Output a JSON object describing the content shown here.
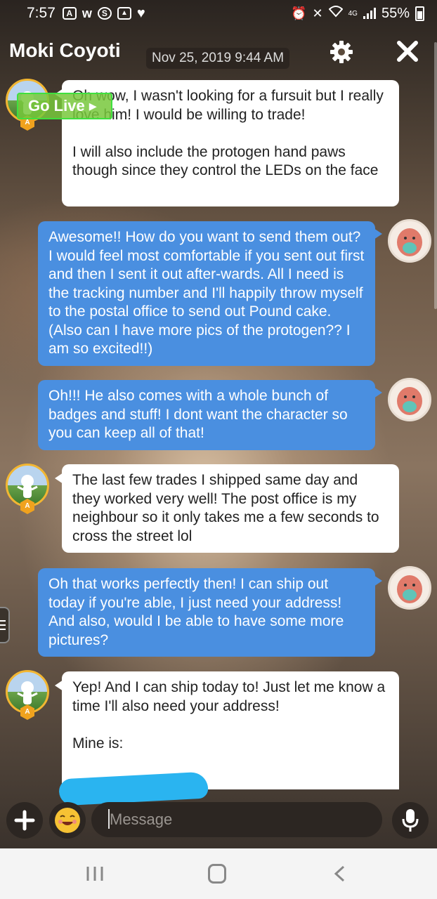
{
  "status_bar": {
    "time": "7:57",
    "network": "4G",
    "battery": "55%",
    "left_icons": [
      "amino-icon",
      "w-icon",
      "s-icon",
      "gallery-icon",
      "heart-icon"
    ],
    "right_icons": [
      "alarm-icon",
      "mute-icon",
      "wifi-icon",
      "signal-icon",
      "battery-icon"
    ]
  },
  "header": {
    "title": "Moki Coyoti",
    "date": "Nov 25, 2019 9:44 AM"
  },
  "go_live_label": "Go Live",
  "messages": [
    {
      "sender": "other",
      "text": "Oh wow, I wasn't looking for a fursuit but I really love him! I would be willing to trade!\n\nI will also include the protogen hand paws though since they control the LEDs on the face"
    },
    {
      "sender": "me",
      "text": "Awesome!! How do you want to send them out? I would feel most comfortable if you sent out first and then I sent it out after-wards. All I need is the tracking number and I'll happily throw myself to the postal office to send out Pound cake. (Also can I have more pics of the protogen?? I am so excited!!)"
    },
    {
      "sender": "me",
      "text": "Oh!!! He also comes with a whole bunch of badges and stuff! I dont want the character so you can keep all of that!"
    },
    {
      "sender": "other",
      "text": "The last few trades I shipped same day and they worked very well! The post office is my neighbour so it only takes me a few seconds to cross the street lol"
    },
    {
      "sender": "me",
      "text": "Oh that works perfectly then! I can ship out today if you're able, I just need your address! And also, would I be able to have some more pictures?"
    },
    {
      "sender": "other",
      "text": "Yep! And I can ship today to! Just let me know a time I'll also need your address!\n\nMine is:"
    }
  ],
  "input": {
    "placeholder": "Message"
  },
  "colors": {
    "outgoing_bubble": "#4a8fe0",
    "incoming_bubble": "#ffffff",
    "avatar_ring": "#f2b632",
    "go_live": "#3fe03f",
    "redaction": "#2ab4f0"
  }
}
